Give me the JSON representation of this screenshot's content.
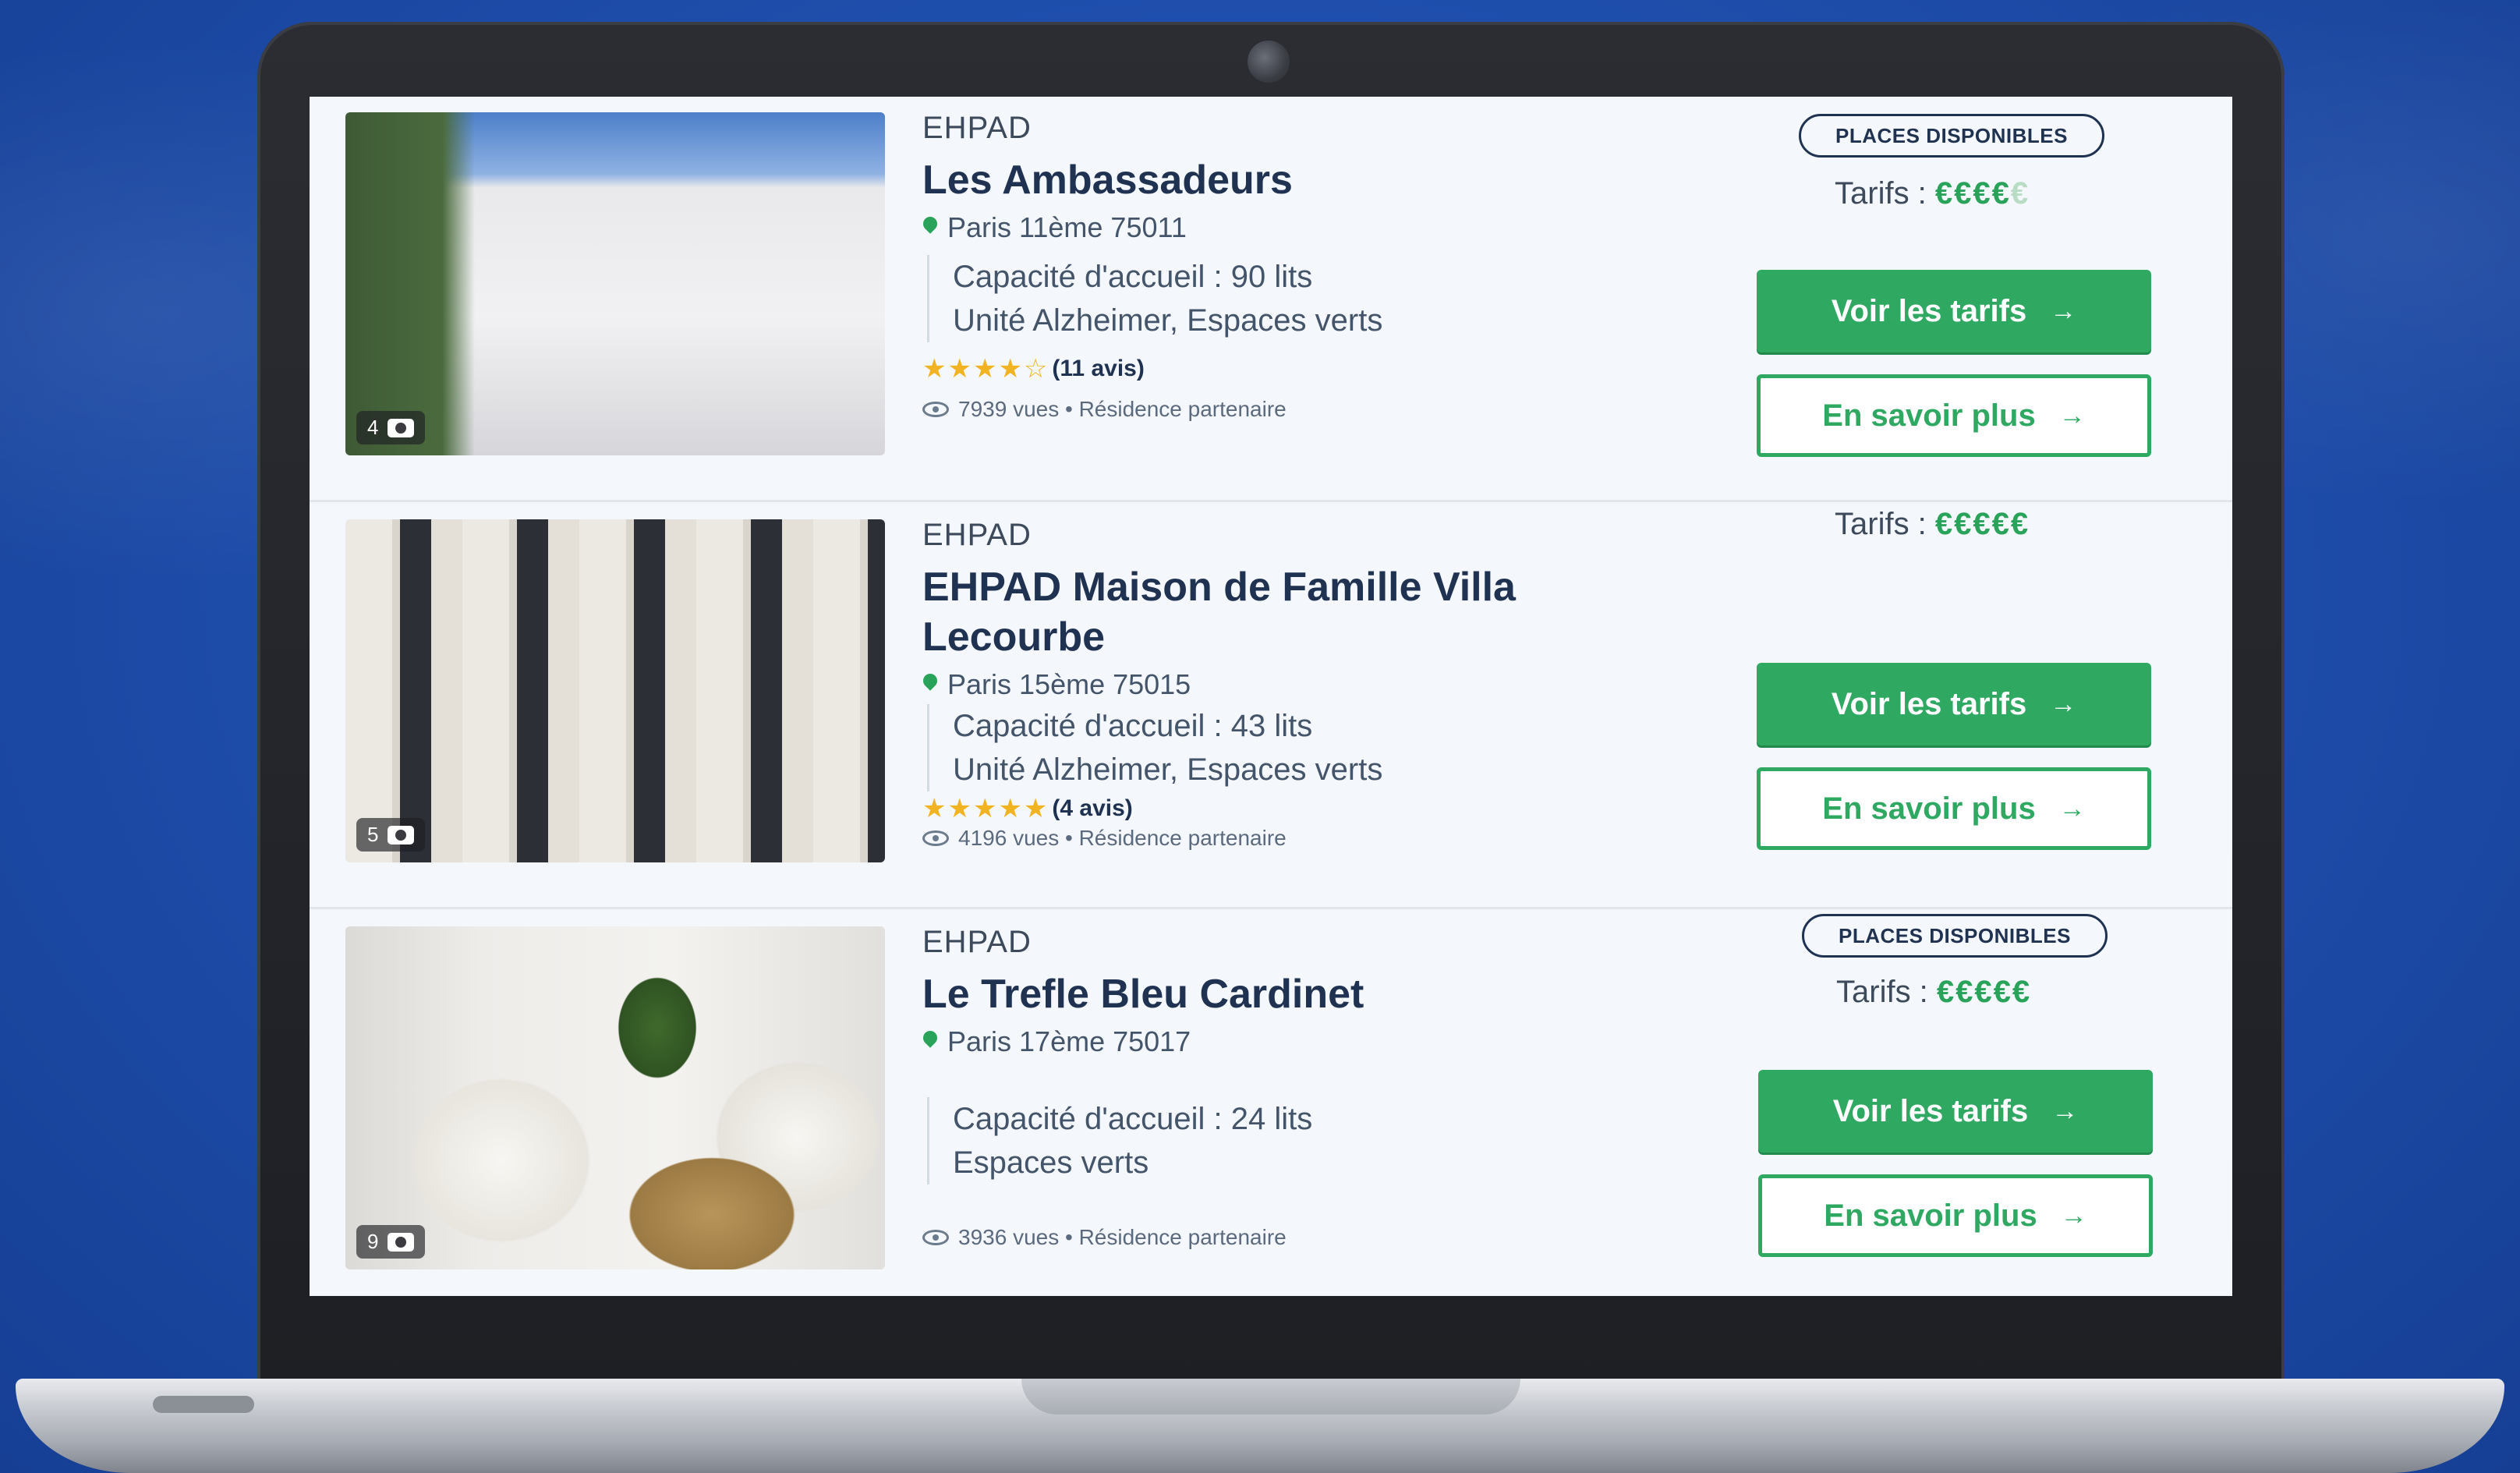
{
  "listings": [
    {
      "category": "EHPAD",
      "title": "Les Ambassadeurs",
      "location": "Paris 11ème 75011",
      "capacity": "Capacité d'accueil : 90 lits",
      "features": "Unité Alzheimer, Espaces verts",
      "stars": "★★★★☆",
      "reviews": "(11 avis)",
      "views": "7939 vues • Résidence partenaire",
      "photo_count": "4",
      "badge": "PLACES DISPONIBLES",
      "tarifs_label": "Tarifs :",
      "tarifs_active": "€€€€",
      "tarifs_inactive": "€",
      "btn_tarifs": "Voir les tarifs",
      "btn_more": "En savoir plus"
    },
    {
      "category": "EHPAD",
      "title": "EHPAD Maison de Famille Villa Lecourbe",
      "location": "Paris 15ème 75015",
      "capacity": "Capacité d'accueil : 43 lits",
      "features": "Unité Alzheimer, Espaces verts",
      "stars": "★★★★★",
      "reviews": "(4 avis)",
      "views": "4196 vues • Résidence partenaire",
      "photo_count": "5",
      "tarifs_label": "Tarifs :",
      "tarifs_active": "€€€€€",
      "btn_tarifs": "Voir les tarifs",
      "btn_more": "En savoir plus"
    },
    {
      "category": "EHPAD",
      "title": "Le Trefle Bleu Cardinet",
      "location": "Paris 17ème 75017",
      "capacity": "Capacité d'accueil : 24 lits",
      "features": "Espaces verts",
      "views": "3936 vues • Résidence partenaire",
      "photo_count": "9",
      "badge": "PLACES DISPONIBLES",
      "tarifs_label": "Tarifs :",
      "tarifs_active": "€€€€€",
      "btn_tarifs": "Voir les tarifs",
      "btn_more": "En savoir plus"
    }
  ],
  "icons": {
    "arrow": "→",
    "pin": "map-pin-icon",
    "eye": "eye-icon",
    "camera": "camera-icon"
  },
  "colors": {
    "accent_green": "#2fa862",
    "title_navy": "#1f3251",
    "star_gold": "#f2b322",
    "background_blue": "#1f4fae"
  },
  "rating_values": [
    4,
    4.5,
    null
  ],
  "price_levels": [
    4,
    5,
    5
  ]
}
